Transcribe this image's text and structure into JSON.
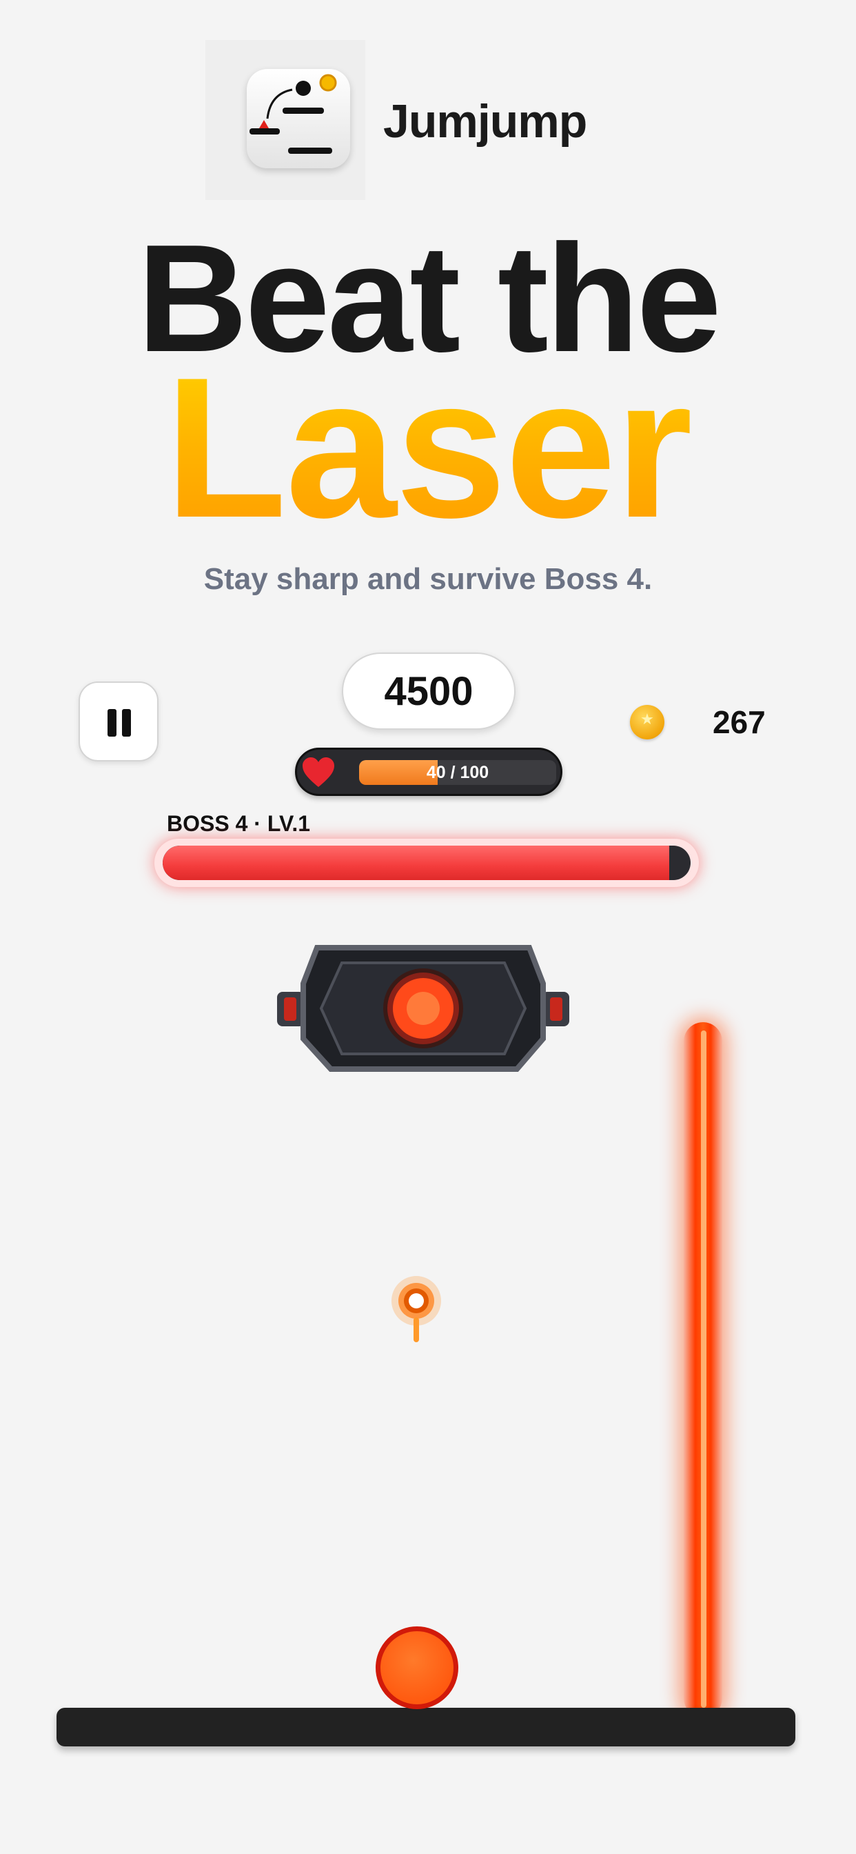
{
  "app": {
    "name": "Jumjump",
    "icon": "jumjump-app-icon"
  },
  "headline": {
    "line1": "Beat the",
    "line2": "Laser",
    "line2_color": "#ffb000"
  },
  "subtitle": "Stay sharp and survive Boss 4.",
  "hud": {
    "score": "4500",
    "coins": "267",
    "coin_icon": "coin-icon",
    "pause_icon": "pause-icon",
    "health": {
      "text": "40 / 100",
      "value": 40,
      "max": 100,
      "icon": "heart-icon",
      "color": "#f07a1d"
    },
    "boss": {
      "label": "BOSS 4 · LV.1",
      "health_fraction": 0.96,
      "color": "#f43c3c"
    }
  },
  "playfield": {
    "boss_icon": "laser-turret-icon",
    "player": "player-ball",
    "projectile": "fireball-icon",
    "hazard": "laser-beam",
    "laser_color": "#ff3c00"
  }
}
